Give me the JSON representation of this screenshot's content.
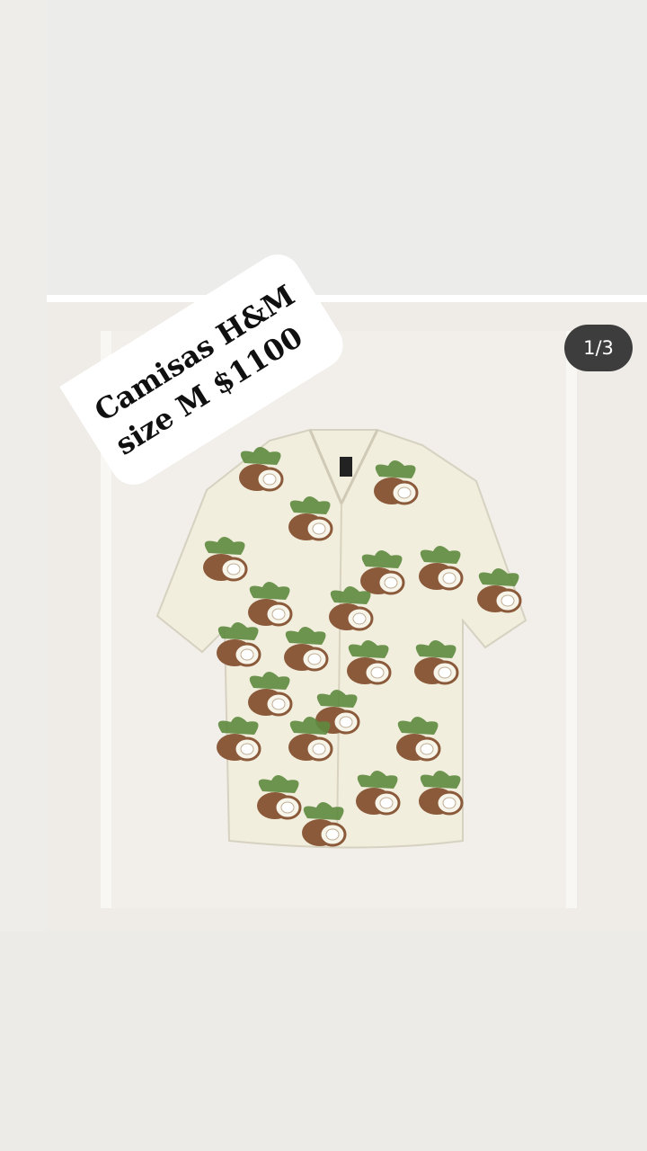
{
  "post": {
    "counter": "1/3",
    "caption_line1": "Camisas H&M",
    "caption_line2": "size M $1100"
  },
  "colors": {
    "shirt": "#f1eedd",
    "coconut": "#8b5a3a",
    "leaf": "#5e8a3e",
    "badge_bg": "#3d3d3d"
  },
  "icons": {
    "product": "shirt-illustration"
  }
}
